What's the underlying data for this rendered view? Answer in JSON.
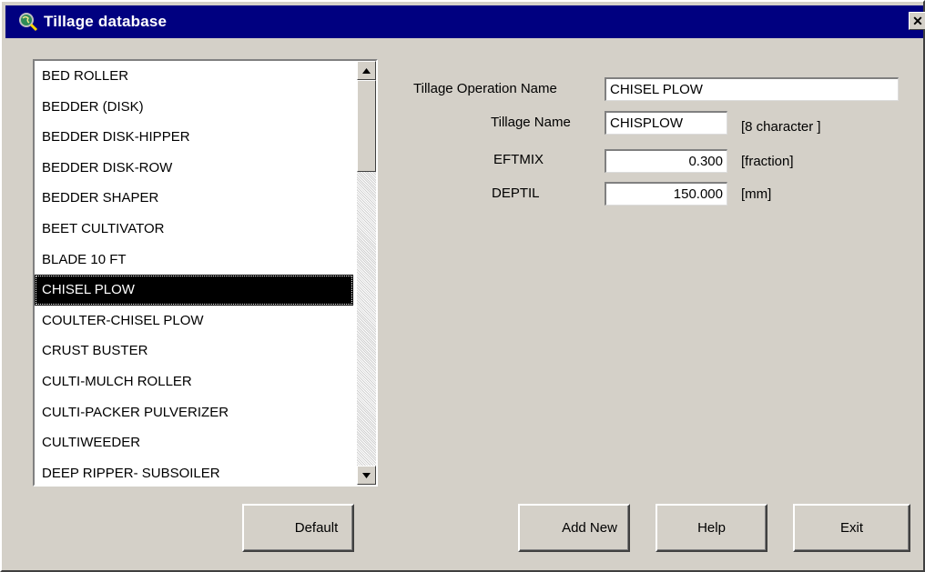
{
  "window": {
    "title": "Tillage database",
    "close_glyph": "✕"
  },
  "tillage_list": {
    "selected": "CHISEL PLOW",
    "items": [
      "BED ROLLER",
      "BEDDER (DISK)",
      "BEDDER DISK-HIPPER",
      "BEDDER DISK-ROW",
      "BEDDER SHAPER",
      "BEET CULTIVATOR",
      "BLADE 10 FT",
      "CHISEL PLOW",
      "COULTER-CHISEL PLOW",
      "CRUST BUSTER",
      "CULTI-MULCH ROLLER",
      "CULTI-PACKER PULVERIZER",
      "CULTIWEEDER",
      "DEEP RIPPER- SUBSOILER"
    ]
  },
  "form": {
    "operation_name_label": "Tillage Operation Name",
    "operation_name_value": "CHISEL PLOW",
    "tillage_name_label": "Tillage Name",
    "tillage_name_value": "CHISPLOW",
    "tillage_name_unit": "[8 character ]",
    "eftmix_label": "EFTMIX",
    "eftmix_value": "0.300",
    "eftmix_unit": "[fraction]",
    "deptil_label": "DEPTIL",
    "deptil_value": "150.000",
    "deptil_unit": "[mm]"
  },
  "buttons": {
    "default": "Default",
    "add_new": "Add New",
    "help": "Help",
    "exit": "Exit"
  },
  "icons": {
    "app": "magnifier-globe-icon",
    "close": "close-icon",
    "scroll_up": "arrow-up-icon",
    "scroll_down": "arrow-down-icon"
  },
  "colors": {
    "titlebar": "#000080",
    "face": "#d4d0c8",
    "selection": "#000000"
  }
}
